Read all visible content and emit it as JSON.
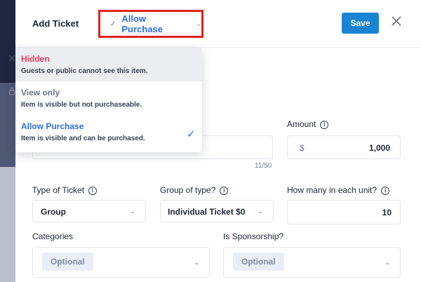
{
  "header": {
    "title": "Add Ticket",
    "visibility_selected": "Allow Purchase",
    "save_label": "Save"
  },
  "visibility_menu": [
    {
      "label": "Hidden",
      "description": "Guests or public cannot see this item.",
      "icon": "close-icon",
      "state": "hovered"
    },
    {
      "label": "View only",
      "description": "Item is visible but not purchaseable.",
      "icon": "lock-icon",
      "state": "normal"
    },
    {
      "label": "Allow Purchase",
      "description": "Item is visible and can be purchased.",
      "icon": "check-icon",
      "state": "selected"
    }
  ],
  "form": {
    "name_counter": "11/50",
    "amount": {
      "label": "Amount",
      "currency": "$",
      "value": "1,000"
    },
    "type_of_ticket": {
      "label": "Type of Ticket",
      "value": "Group"
    },
    "group_of_type": {
      "label": "Group of type?",
      "value": "Individual Ticket $0"
    },
    "units": {
      "label": "How many in each unit?",
      "value": "10"
    },
    "categories": {
      "label": "Categories",
      "placeholder": "Optional"
    },
    "sponsorship": {
      "label": "Is Sponsorship?",
      "placeholder": "Optional"
    }
  },
  "colors": {
    "accent": "#2f6fe0",
    "save": "#1a84d4",
    "highlight_border": "#e0231b",
    "hidden_label": "#e34060"
  }
}
